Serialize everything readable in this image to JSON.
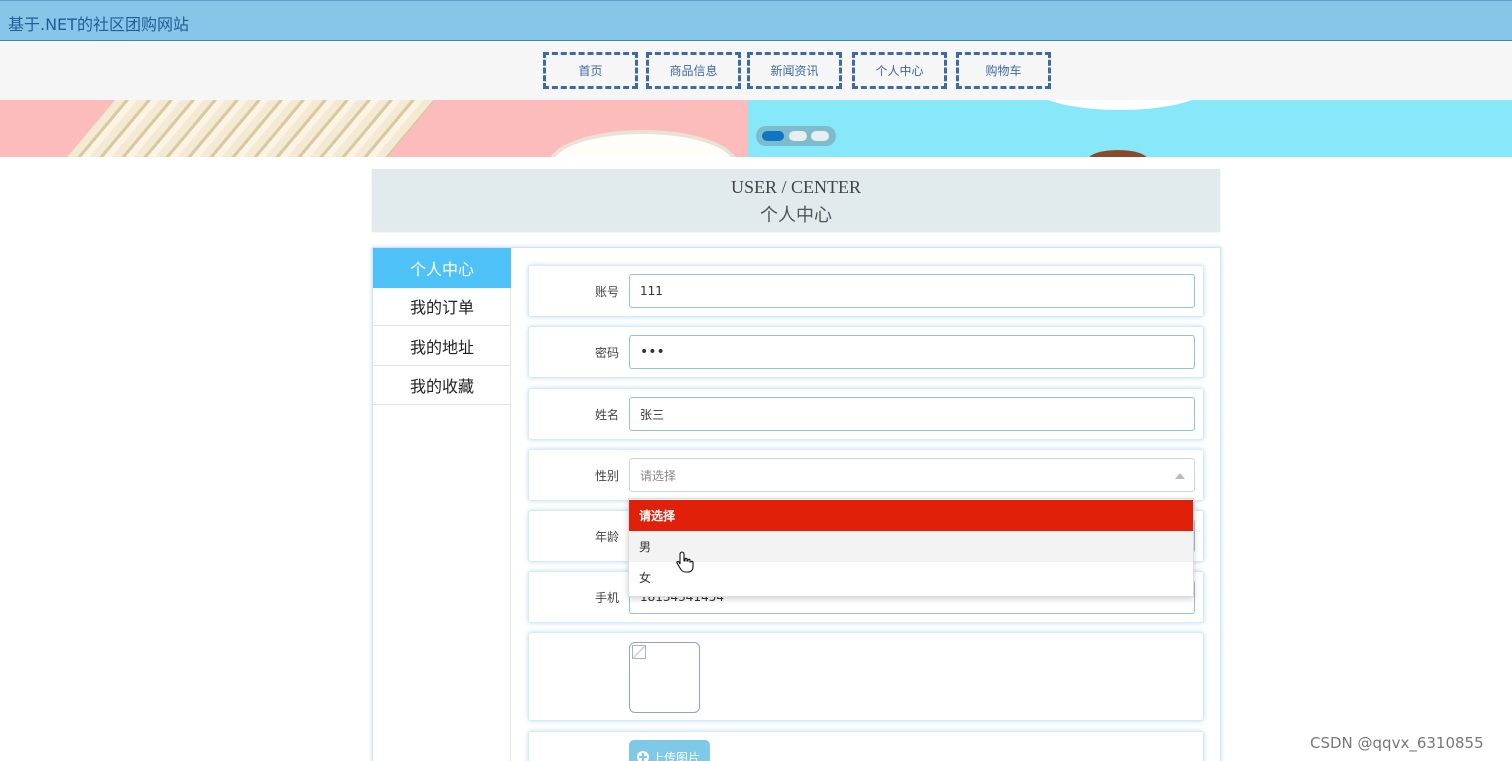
{
  "header": {
    "site_title": "基于.NET的社区团购网站"
  },
  "nav": {
    "items": [
      {
        "label": "首页"
      },
      {
        "label": "商品信息"
      },
      {
        "label": "新闻资讯"
      },
      {
        "label": "个人中心"
      },
      {
        "label": "购物车"
      }
    ]
  },
  "banner": {
    "slide_count": 3,
    "active_slide": 1
  },
  "section": {
    "title_en": "USER / CENTER",
    "title_cn": "个人中心"
  },
  "sidebar": {
    "items": [
      {
        "label": "个人中心",
        "active": true
      },
      {
        "label": "我的订单",
        "active": false
      },
      {
        "label": "我的地址",
        "active": false
      },
      {
        "label": "我的收藏",
        "active": false
      }
    ]
  },
  "form": {
    "account": {
      "label": "账号",
      "value": "111"
    },
    "password": {
      "label": "密码",
      "value": "•••"
    },
    "name": {
      "label": "姓名",
      "value": "张三"
    },
    "gender": {
      "label": "性别",
      "placeholder": "请选择",
      "options": [
        "请选择",
        "男",
        "女"
      ],
      "selected_option": "请选择",
      "hovered_option": "男"
    },
    "age": {
      "label": "年龄"
    },
    "phone": {
      "label": "手机",
      "value": "18134341454"
    },
    "upload_button_label": "上传图片"
  },
  "colors": {
    "topbar": "#86c6e9",
    "nav_border": "#3d6aa3",
    "sidebar_active": "#4ec2f7",
    "dropdown_selected": "#e02008",
    "upload_button": "#7ec8e8"
  },
  "watermark": "CSDN @qqvx_6310855"
}
